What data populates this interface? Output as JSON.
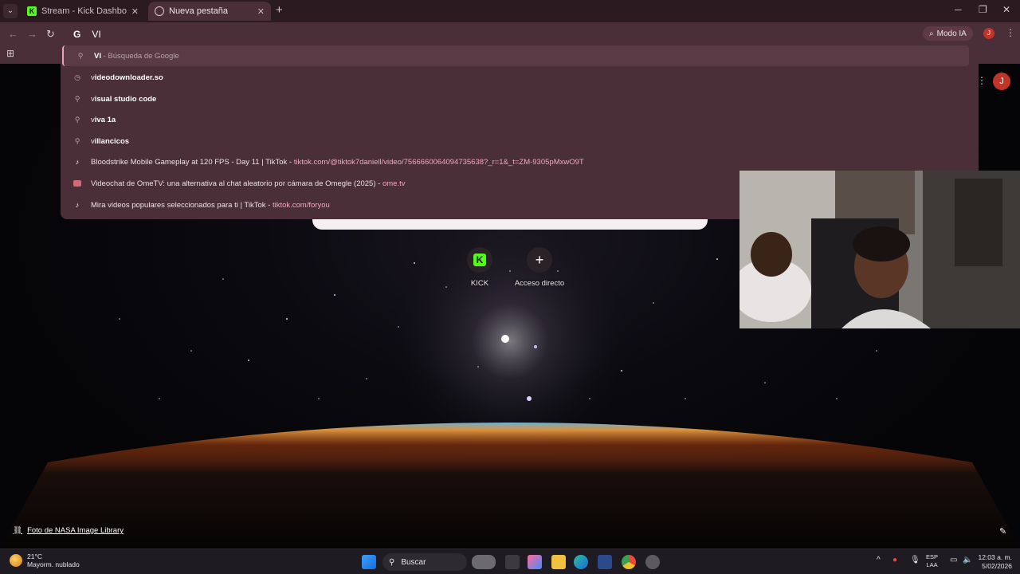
{
  "browser": {
    "tabs": [
      {
        "label": "Stream - Kick Dashboard",
        "active": false,
        "icon": "kick-icon"
      },
      {
        "label": "Nueva pestaña",
        "active": true,
        "icon": "globe-icon"
      }
    ],
    "omnibox_value": "VI",
    "modo_ia_label": "Modo IA",
    "profile_initial": "J"
  },
  "suggestions": [
    {
      "type": "search",
      "icon": "search-icon",
      "bold": "VI",
      "rest": "",
      "dim": " - Búsqueda de Google",
      "link": ""
    },
    {
      "type": "history",
      "icon": "history-icon",
      "bold": "",
      "prefix": "v",
      "rest": "ideodownloader.so",
      "dim": "",
      "link": ""
    },
    {
      "type": "search",
      "icon": "search-icon",
      "prefix": "v",
      "rest": "isual studio code",
      "dim": "",
      "link": ""
    },
    {
      "type": "search",
      "icon": "search-icon",
      "prefix": "v",
      "rest": "iva 1a",
      "dim": "",
      "link": ""
    },
    {
      "type": "search",
      "icon": "search-icon",
      "prefix": "v",
      "rest": "illancicos",
      "dim": "",
      "link": ""
    },
    {
      "type": "site",
      "icon": "tiktok-icon",
      "text": "Bloodstrike Mobile Gameplay at 120 FPS - Day 11 | TikTok",
      "link": "tiktok.com/@tiktok7daniell/video/7566660064094735638?_r=1&_t=ZM-9305pMxwO9T"
    },
    {
      "type": "site",
      "icon": "ometv-icon",
      "text": "Videochat de OmeTV: una alternativa al chat aleatorio por cámara de Omegle (2025)",
      "link": "ome.tv"
    },
    {
      "type": "site",
      "icon": "tiktok-icon",
      "text": "Mira videos populares seleccionados para ti | TikTok",
      "link": "tiktok.com/foryou"
    }
  ],
  "shortcuts": [
    {
      "label": "KICK",
      "icon": "kick-icon"
    },
    {
      "label": "Acceso directo",
      "icon": "plus-icon"
    }
  ],
  "background_credit": "Foto de NASA Image Library",
  "taskbar": {
    "weather_temp": "21°C",
    "weather_desc": "Mayorm. nublado",
    "search_label": "Buscar",
    "lang_line1": "ESP",
    "lang_line2": "LAA",
    "time": "12:03 a. m.",
    "date": "5/02/2026"
  },
  "colors": {
    "tabstrip": "#2b1a20",
    "toolbar": "#4a2e38",
    "kick_green": "#53fc18",
    "link_pink": "#f2a8c0"
  }
}
